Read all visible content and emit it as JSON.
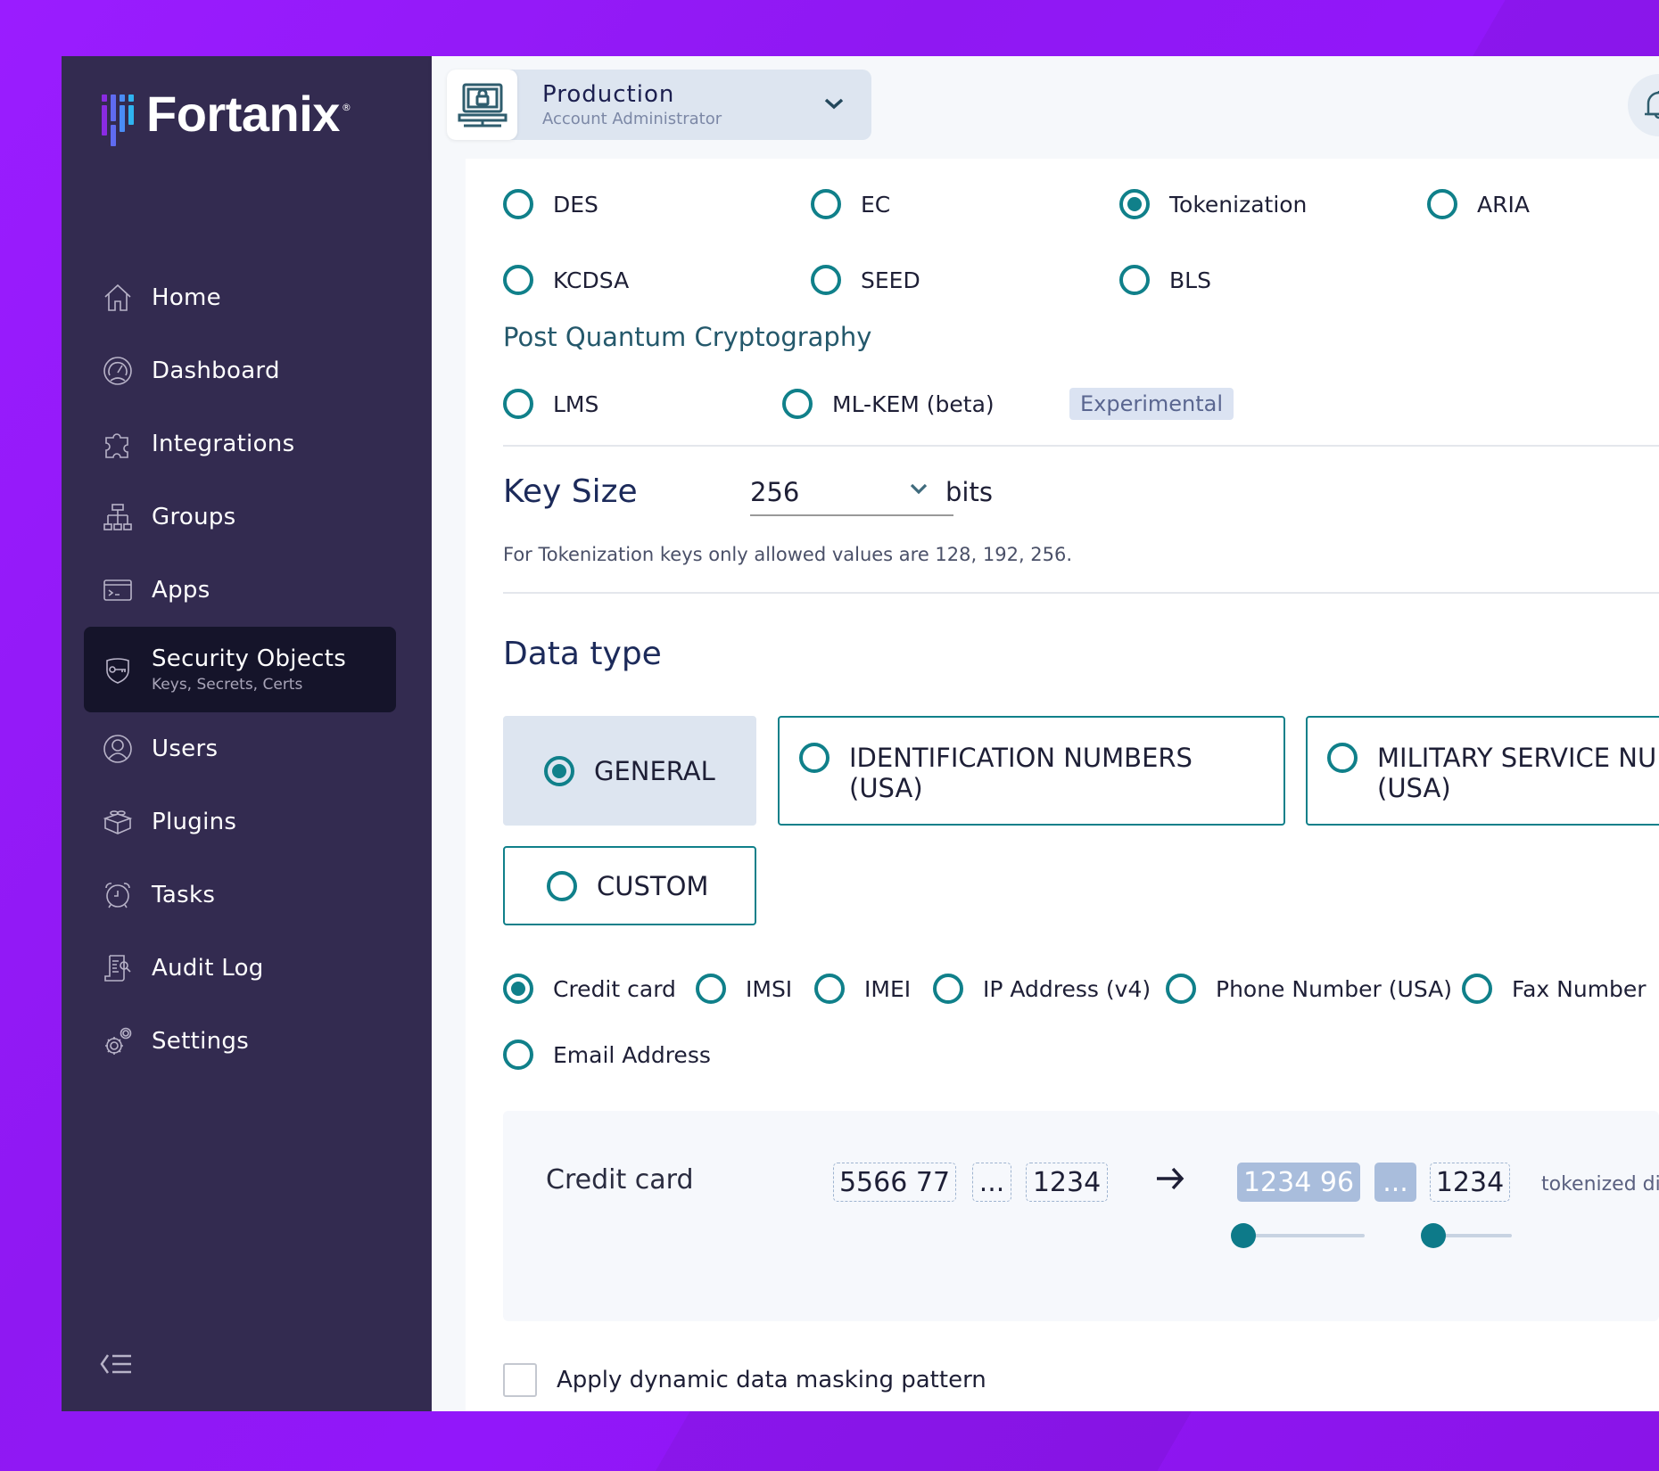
{
  "brand": {
    "name": "Fortanix",
    "registered": "®"
  },
  "sidebar": {
    "items": [
      {
        "label": "Home",
        "icon": "home-icon"
      },
      {
        "label": "Dashboard",
        "icon": "dashboard-gauge-icon"
      },
      {
        "label": "Integrations",
        "icon": "puzzle-icon"
      },
      {
        "label": "Groups",
        "icon": "hierarchy-icon"
      },
      {
        "label": "Apps",
        "icon": "terminal-window-icon"
      },
      {
        "label": "Security Objects",
        "sublabel": "Keys, Secrets, Certs",
        "icon": "shield-key-icon",
        "active": true
      },
      {
        "label": "Users",
        "icon": "user-circle-icon"
      },
      {
        "label": "Plugins",
        "icon": "brick-icon"
      },
      {
        "label": "Tasks",
        "icon": "alarm-clock-icon"
      },
      {
        "label": "Audit Log",
        "icon": "audit-scroll-icon"
      },
      {
        "label": "Settings",
        "icon": "gears-icon"
      }
    ],
    "collapse_icon": "collapse-sidebar-icon"
  },
  "header": {
    "account": {
      "name": "Production",
      "role": "Account Administrator",
      "icon": "laptop-lock-icon"
    },
    "notifications_icon": "bell-icon"
  },
  "key_types": {
    "row1": [
      {
        "label": "DES",
        "selected": false
      },
      {
        "label": "EC",
        "selected": false
      },
      {
        "label": "Tokenization",
        "selected": true
      },
      {
        "label": "ARIA",
        "selected": false
      }
    ],
    "row2": [
      {
        "label": "KCDSA",
        "selected": false
      },
      {
        "label": "SEED",
        "selected": false
      },
      {
        "label": "BLS",
        "selected": false
      }
    ]
  },
  "pqc": {
    "title": "Post Quantum Cryptography",
    "options": [
      {
        "label": "LMS",
        "selected": false
      },
      {
        "label": "ML-KEM (beta)",
        "selected": false,
        "badge": "Experimental"
      }
    ]
  },
  "key_size": {
    "label": "Key Size",
    "value": "256",
    "unit": "bits",
    "hint": "For Tokenization keys only allowed values are 128, 192, 256."
  },
  "data_type": {
    "title": "Data type",
    "cards": [
      {
        "label": "GENERAL",
        "selected": true
      },
      {
        "label": "IDENTIFICATION NUMBERS (USA)",
        "line1": "IDENTIFICATION NUMBERS",
        "line2": "(USA)",
        "selected": false
      },
      {
        "label": "MILITARY SERVICE NUMBERS (USA)",
        "line1": "MILITARY SERVICE NUM",
        "line2": "(USA)",
        "selected": false
      },
      {
        "label": "CUSTOM",
        "selected": false
      }
    ],
    "formats": [
      {
        "label": "Credit card",
        "selected": true
      },
      {
        "label": "IMSI",
        "selected": false
      },
      {
        "label": "IMEI",
        "selected": false
      },
      {
        "label": "IP Address (v4)",
        "selected": false
      },
      {
        "label": "Phone Number (USA)",
        "selected": false
      },
      {
        "label": "Fax Number",
        "selected": false
      },
      {
        "label": "Email Address",
        "selected": false
      }
    ]
  },
  "preview": {
    "label": "Credit card",
    "input_segments": [
      "5566 77",
      "...",
      "1234"
    ],
    "output_segments": [
      "1234 96",
      "...",
      "1234"
    ],
    "note": "tokenized dig",
    "slider_left_value": 0,
    "slider_right_value": 0
  },
  "masking": {
    "label": "Apply dynamic data masking pattern",
    "checked": false
  },
  "colors": {
    "accent_teal": "#10808a",
    "sidebar_bg": "#332b50",
    "sidebar_active_bg": "#15142a",
    "background_purple": "#9a1cff",
    "selected_card_bg": "#dde5f0",
    "token_highlight": "#a9bddc"
  }
}
